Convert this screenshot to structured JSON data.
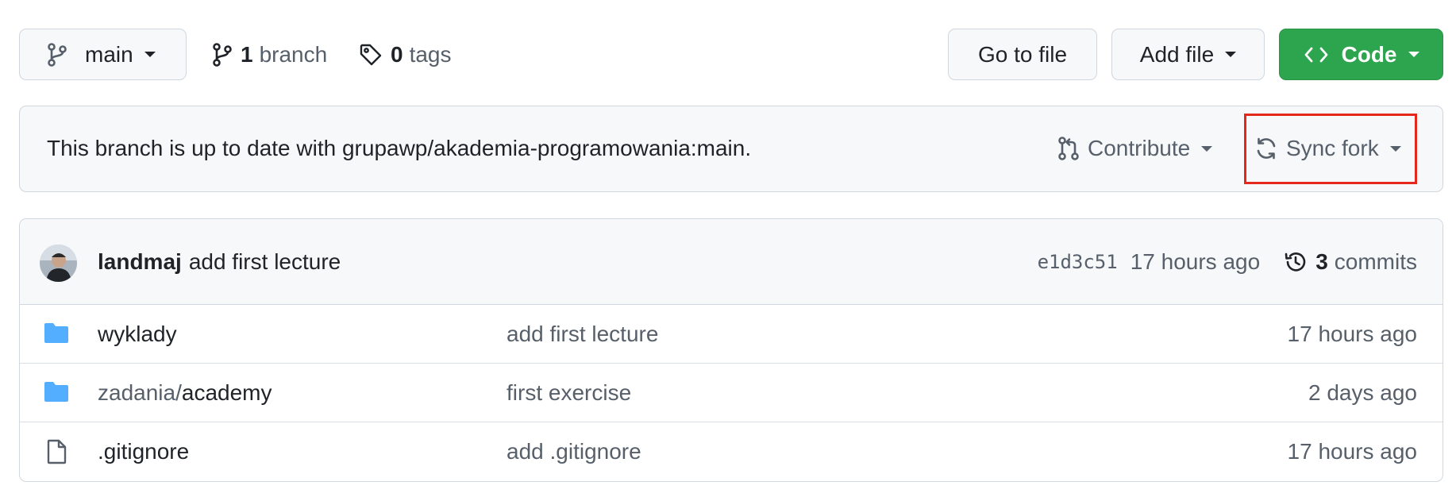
{
  "toolbar": {
    "branch_select": {
      "label": "main",
      "icon": "git-branch-icon"
    },
    "branches_link": {
      "count": "1",
      "label": "branch",
      "icon": "git-branch-icon"
    },
    "tags_link": {
      "count": "0",
      "label": "tags",
      "icon": "tag-icon"
    },
    "go_to_file_label": "Go to file",
    "add_file_label": "Add file",
    "code_button": {
      "label": "Code",
      "icon": "code-icon",
      "color": "#2da44e"
    }
  },
  "fork_status": {
    "message": "This branch is up to date with grupawp/akademia-programowania:main.",
    "contribute_label": "Contribute",
    "contribute_icon": "git-pull-request-icon",
    "sync_fork_label": "Sync fork",
    "sync_fork_icon": "sync-icon",
    "highlight_color": "#e5281c"
  },
  "latest_commit": {
    "author": "landmaj",
    "message": "add first lecture",
    "sha": "e1d3c51",
    "time": "17 hours ago",
    "commits_count": "3",
    "commits_label": "commits",
    "history_icon": "history-icon"
  },
  "files": [
    {
      "type": "directory",
      "icon": "folder-icon",
      "prefix": "",
      "name": "wyklady",
      "commit_message": "add first lecture",
      "age": "17 hours ago"
    },
    {
      "type": "directory",
      "icon": "folder-icon",
      "prefix": "zadania/",
      "name": "academy",
      "commit_message": "first exercise",
      "age": "2 days ago"
    },
    {
      "type": "file",
      "icon": "file-icon",
      "prefix": "",
      "name": ".gitignore",
      "commit_message": "add .gitignore",
      "age": "17 hours ago"
    }
  ]
}
